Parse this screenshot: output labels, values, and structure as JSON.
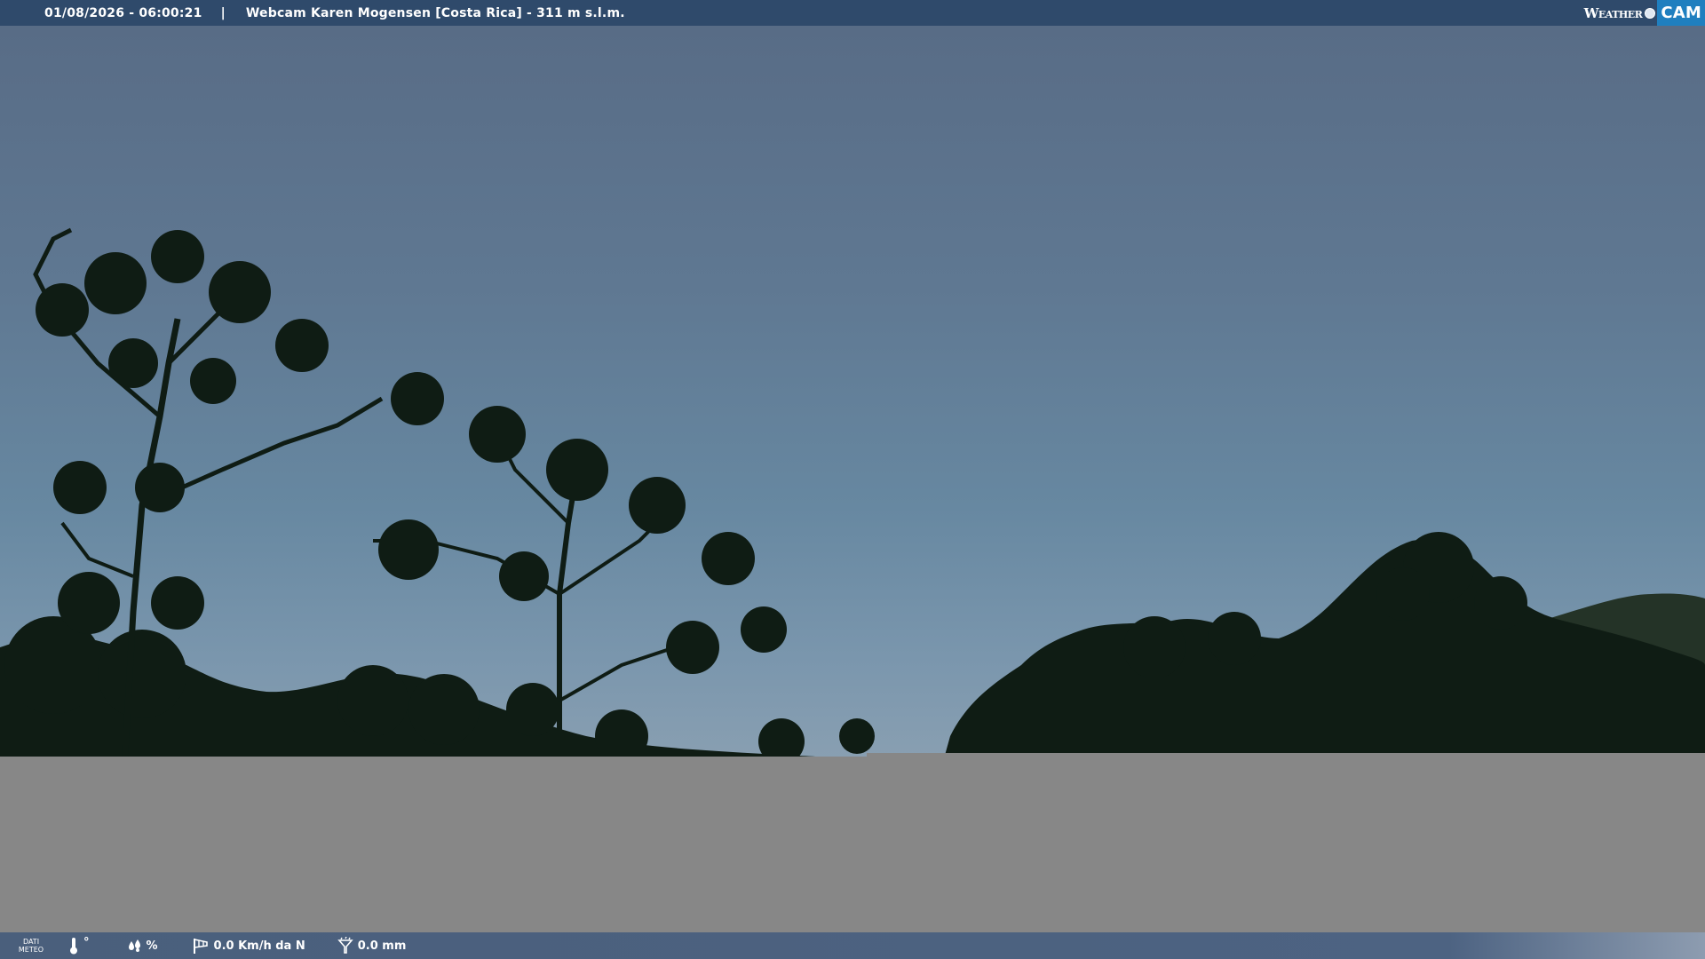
{
  "overlay": {
    "timestamp": "01/08/2026 - 06:00:21",
    "separator": "|",
    "caption": "Webcam Karen Mogensen [Costa Rica]  - 311 m s.l.m."
  },
  "logo": {
    "weather": "Weather",
    "cam": "CAM"
  },
  "weather_bar": {
    "dati_line1": "DATI",
    "dati_line2": "METEO",
    "temperature": "°",
    "humidity": "%",
    "wind": "0.0 Km/h da N",
    "rain": "0.0 mm"
  },
  "icons": {
    "temperature": "thermometer-icon",
    "humidity": "humidity-drops-icon",
    "wind": "wind-sock-icon",
    "rain": "rain-gauge-icon"
  },
  "colors": {
    "top_bar": "#2f4a6b",
    "sky": "#6788a1",
    "foliage": "#0f1c14",
    "grey_area": "#878787",
    "bottom_bar": "#4a5f7c",
    "cam_badge": "#1f7fbf"
  }
}
